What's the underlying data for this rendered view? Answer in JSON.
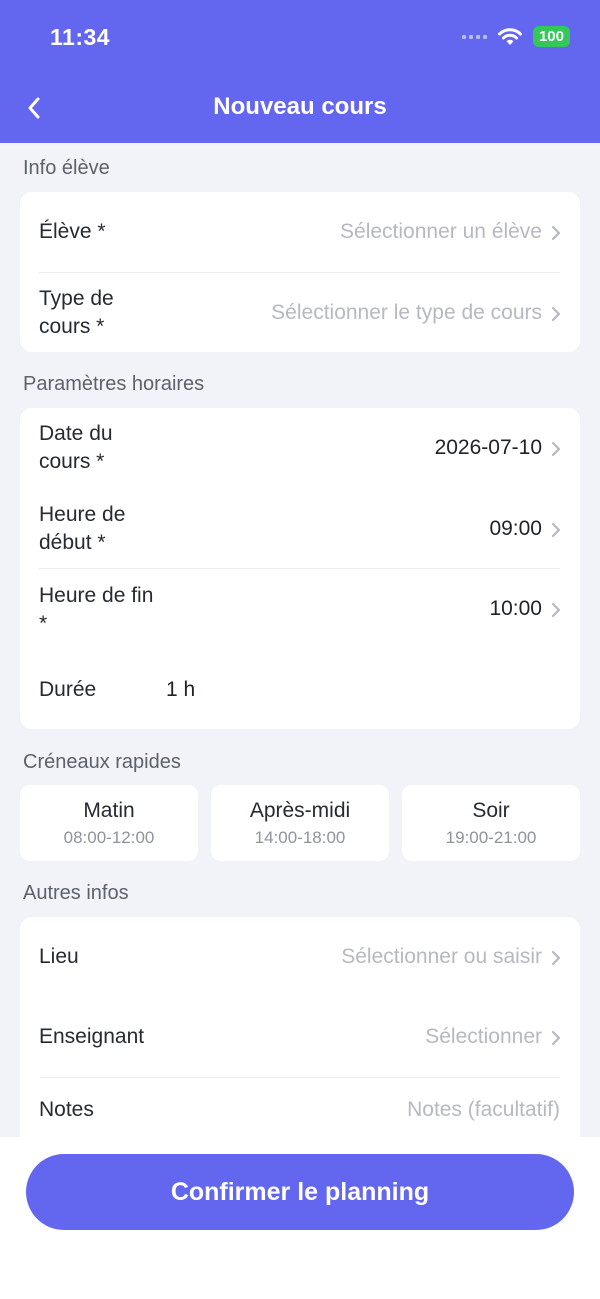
{
  "status_bar": {
    "time": "11:34",
    "battery": "100"
  },
  "nav": {
    "title": "Nouveau cours"
  },
  "sections": {
    "student": "Info élève",
    "schedule": "Paramètres horaires",
    "quick_slots": "Créneaux rapides",
    "other": "Autres infos"
  },
  "student_info": {
    "student_label": "Élève *",
    "student_placeholder": "Sélectionner un élève",
    "type_label_line1": "Type de",
    "type_label_line2": "cours *",
    "type_placeholder": "Sélectionner le type de cours"
  },
  "schedule": {
    "date_label_line1": "Date du",
    "date_label_line2": "cours *",
    "date_value": "2026-07-10",
    "start_label_line1": "Heure de",
    "start_label_line2": "début *",
    "start_value": "09:00",
    "end_label_line1": "Heure de fin",
    "end_label_line2": "*",
    "end_value": "10:00",
    "duration_label": "Durée",
    "duration_value": "1 h"
  },
  "quick_slots": [
    {
      "name": "Matin",
      "time": "08:00-12:00"
    },
    {
      "name": "Après-midi",
      "time": "14:00-18:00"
    },
    {
      "name": "Soir",
      "time": "19:00-21:00"
    }
  ],
  "other_info": {
    "place_label": "Lieu",
    "place_placeholder": "Sélectionner ou saisir",
    "teacher_label": "Enseignant",
    "teacher_placeholder": "Sélectionner",
    "notes_label": "Notes",
    "notes_placeholder": "Notes (facultatif)"
  },
  "actions": {
    "confirm": "Confirmer le planning"
  },
  "colors": {
    "primary": "#6366ef",
    "background": "#f2f3f8",
    "battery": "#34c759",
    "placeholder": "#b6b9c0"
  }
}
